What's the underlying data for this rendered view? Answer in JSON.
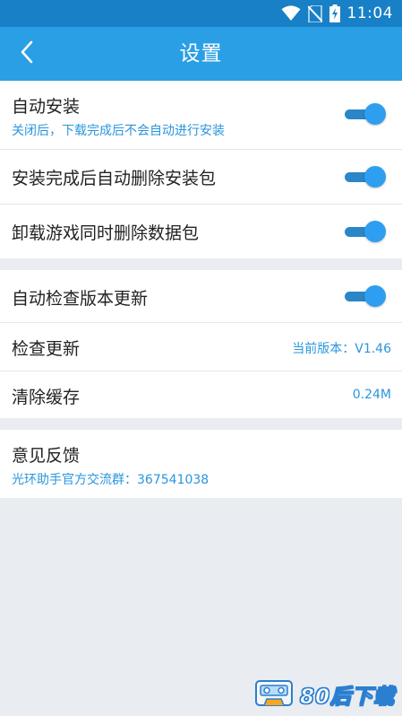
{
  "status_bar": {
    "time": "11:04",
    "icons": [
      "wifi-icon",
      "no-sim-icon",
      "battery-charging-icon"
    ]
  },
  "header": {
    "title": "设置",
    "back_icon": "chevron-left-icon"
  },
  "settings": {
    "auto_install": {
      "label": "自动安装",
      "description": "关闭后，下载完成后不会自动进行安装",
      "enabled": true
    },
    "delete_package_after_install": {
      "label": "安装完成后自动删除安装包",
      "enabled": true
    },
    "delete_data_on_uninstall": {
      "label": "卸载游戏同时删除数据包",
      "enabled": true
    },
    "auto_check_update": {
      "label": "自动检查版本更新",
      "enabled": true
    },
    "check_update": {
      "label": "检查更新",
      "value": "当前版本：V1.46"
    },
    "clear_cache": {
      "label": "清除缓存",
      "value": "0.24M"
    },
    "feedback": {
      "label": "意见反馈",
      "description": "光环助手官方交流群：367541038"
    }
  },
  "watermark": {
    "text": "80后下载"
  },
  "colors": {
    "status_bar": "#1880c6",
    "app_bar": "#2a9fe5",
    "accent": "#2a96dc",
    "background": "#e9edf1"
  }
}
